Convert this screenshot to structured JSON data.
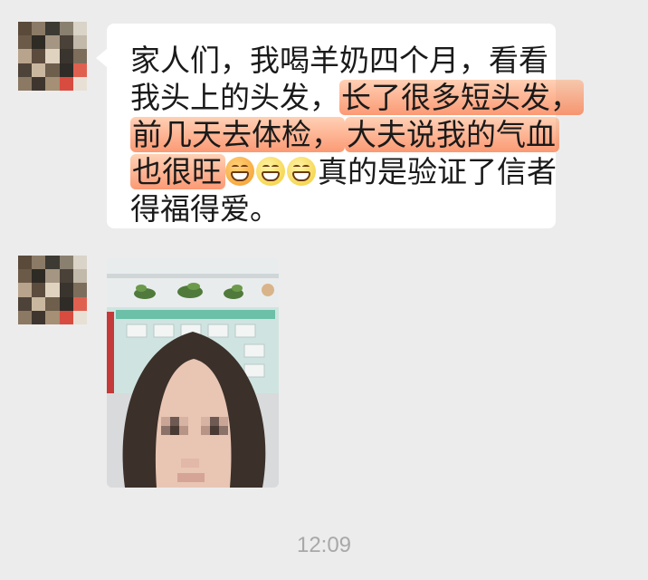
{
  "chat": {
    "messages": [
      {
        "type": "text",
        "lines": [
          {
            "text": "家人们，我喝羊奶四个月，看看"
          },
          {
            "text_a": "我头上的头发，",
            "text_b": "长了很多短头发，"
          },
          {
            "text_a": "前几天去体检，",
            "text_b": "大夫说我的气血"
          },
          {
            "text_a": "也很旺",
            "text_b": "真的是验证了信者"
          },
          {
            "text": "得福得爱。"
          }
        ],
        "emojis": [
          "grinning-face-emoji",
          "grinning-face-emoji",
          "grinning-face-emoji"
        ],
        "highlight_color": "#f7925a"
      },
      {
        "type": "image",
        "image_description_icon": "photo-thumbnail-icon"
      }
    ],
    "timestamp": "12:09"
  },
  "colors": {
    "background": "#ececec",
    "bubble": "#ffffff",
    "timestamp": "#a8a8a8"
  }
}
